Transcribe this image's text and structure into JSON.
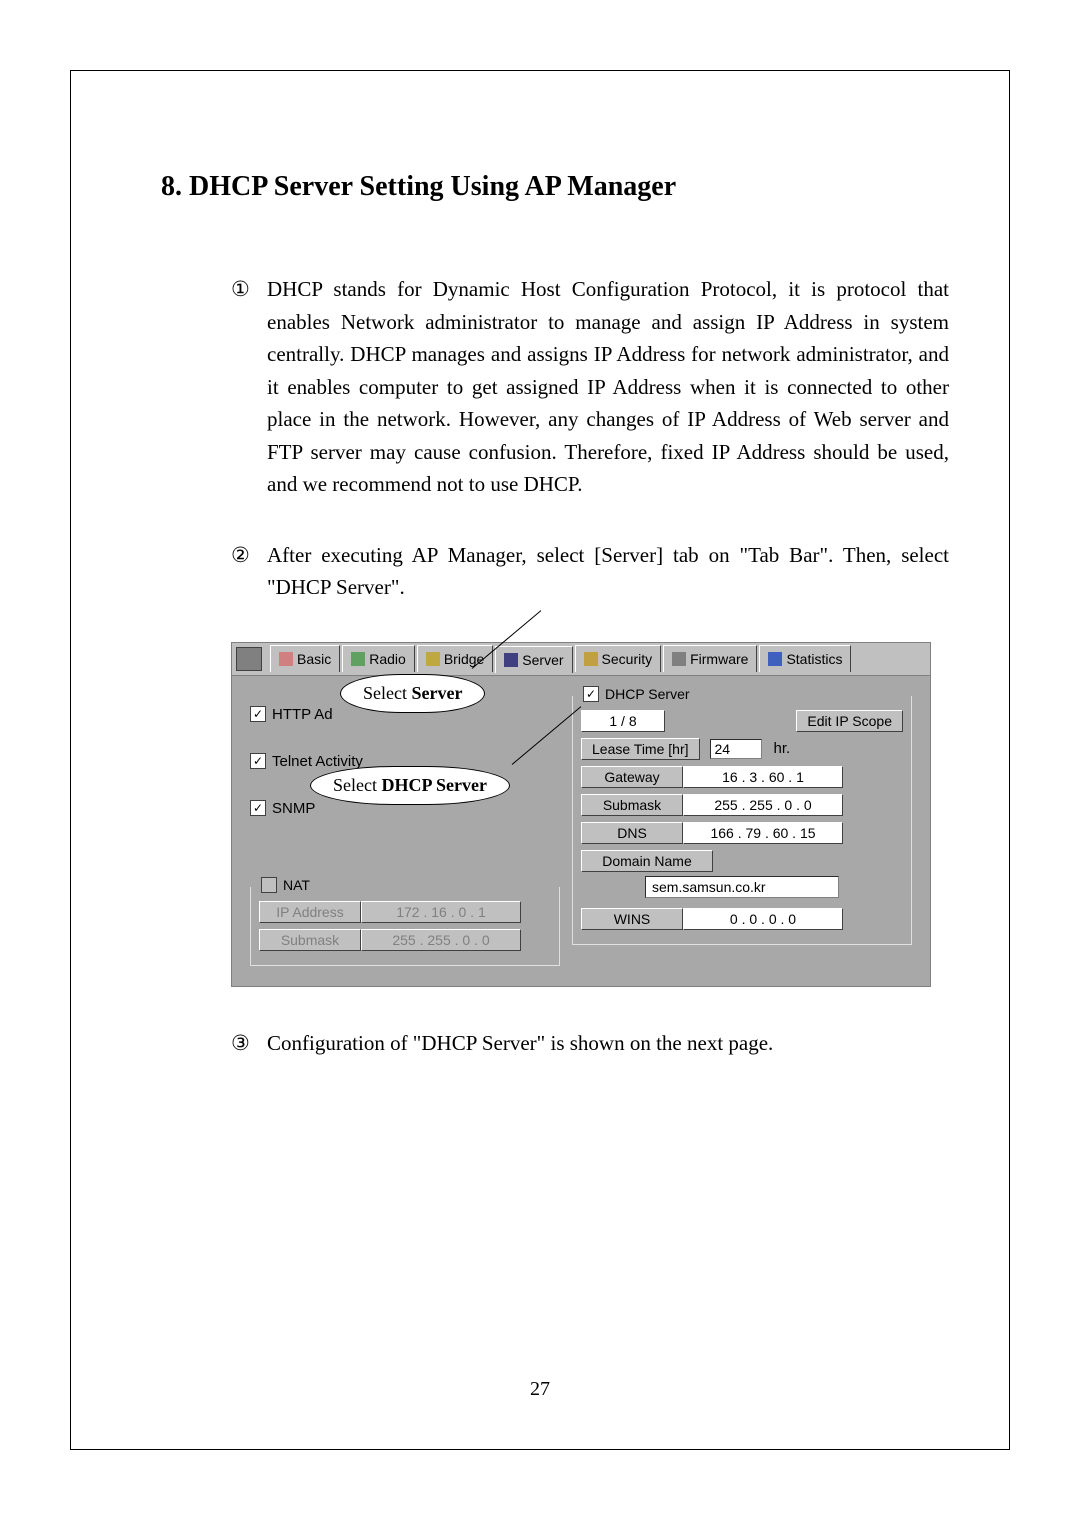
{
  "section_title": "8. DHCP Server Setting Using AP Manager",
  "items": {
    "n1": "①",
    "t1": "DHCP stands for Dynamic Host Configuration Protocol, it is protocol that enables Network administrator to manage and assign IP Address in system centrally. DHCP manages and assigns IP Address for network administrator, and it enables computer to get assigned IP Address when it is connected to other place in the network. However, any changes of IP Address of Web server and FTP server may cause confusion. Therefore, fixed IP Address should be used, and we recommend not to use DHCP.",
    "n2": "②",
    "t2": "After executing AP Manager, select [Server] tab on \"Tab Bar\". Then, select \"DHCP Server\".",
    "n3": "③",
    "t3": "Configuration of \"DHCP Server\" is shown on the next page."
  },
  "callouts": {
    "server_pre": "Select ",
    "server_b": "Server",
    "dhcp_pre": "Select ",
    "dhcp_b": "DHCP Server"
  },
  "tabs": {
    "basic": "Basic",
    "radio": "Radio",
    "bridge": "Bridge",
    "server": "Server",
    "security": "Security",
    "firmware": "Firmware",
    "statistics": "Statistics"
  },
  "left": {
    "http": "HTTP Ad",
    "telnet": "Telnet Activity",
    "snmp": "SNMP",
    "nat_legend": "NAT",
    "ip_label": "IP Address",
    "ip_value": "172 . 16  .  0  .  1",
    "sub_label": "Submask",
    "sub_value": "255 . 255 .  0  .  0"
  },
  "right": {
    "dhcp_legend": "DHCP Server",
    "scope_count": "1 / 8",
    "edit_scope": "Edit IP Scope",
    "lease_btn": "Lease Time [hr]",
    "lease_val": "24",
    "hr": "hr.",
    "gateway_btn": "Gateway",
    "gateway_val": "16  .  3  . 60  .  1",
    "sub_btn": "Submask",
    "sub_val": "255 . 255 .  0  .  0",
    "dns_btn": "DNS",
    "dns_val": "166 . 79  . 60  . 15",
    "domain_btn": "Domain Name",
    "domain_val": "sem.samsun.co.kr",
    "wins_btn": "WINS",
    "wins_val": "0  .  0  .  0  .  0"
  },
  "page_number": "27"
}
